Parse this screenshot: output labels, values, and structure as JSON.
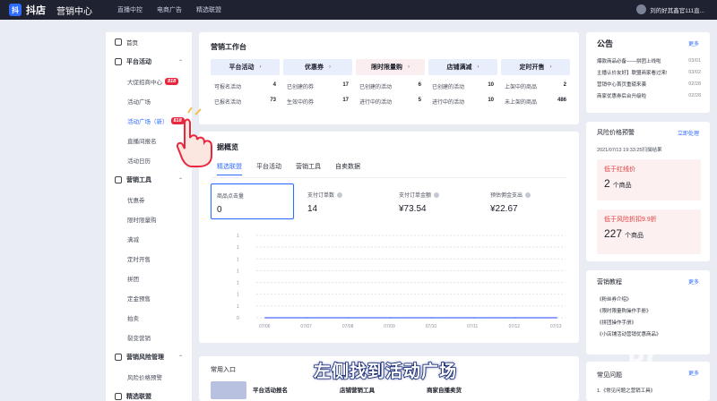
{
  "topbar": {
    "logo_char": "抖",
    "brand": "抖店",
    "section": "营销中心",
    "nav": [
      "直播中控",
      "电商广告",
      "精选联盟"
    ],
    "user": "刘的好其鑫官111直..."
  },
  "sidebar": {
    "items": [
      {
        "type": "top",
        "label": "首页",
        "icon": "home-icon"
      },
      {
        "type": "group",
        "label": "平台活动",
        "icon": "activity-icon"
      },
      {
        "type": "sub",
        "label": "大促招商中心",
        "badge": "818"
      },
      {
        "type": "sub",
        "label": "活动广场"
      },
      {
        "type": "sub",
        "label": "活动广场（新）",
        "badge": "818"
      },
      {
        "type": "sub",
        "label": "直播间报名"
      },
      {
        "type": "sub",
        "label": "活动日历"
      },
      {
        "type": "group",
        "label": "营销工具",
        "icon": "tool-icon"
      },
      {
        "type": "sub",
        "label": "优惠券"
      },
      {
        "type": "sub",
        "label": "限时限量购"
      },
      {
        "type": "sub",
        "label": "满减"
      },
      {
        "type": "sub",
        "label": "定时开售"
      },
      {
        "type": "sub",
        "label": "拼团"
      },
      {
        "type": "sub",
        "label": "定金预售"
      },
      {
        "type": "sub",
        "label": "拍卖"
      },
      {
        "type": "sub",
        "label": "裂变营销"
      },
      {
        "type": "group",
        "label": "营销风险管理",
        "icon": "shield-icon"
      },
      {
        "type": "sub",
        "label": "风险价格预警"
      },
      {
        "type": "group",
        "label": "精选联盟",
        "icon": "union-icon"
      }
    ]
  },
  "workbench": {
    "title": "营销工作台",
    "tiles": [
      {
        "name": "平台活动",
        "bg": "#e9eefc",
        "rows": [
          [
            "可报名活动",
            "4"
          ],
          [
            "已报名活动",
            "73"
          ]
        ]
      },
      {
        "name": "优惠券",
        "bg": "#e9eefc",
        "rows": [
          [
            "已创建的券",
            "17"
          ],
          [
            "生效中的券",
            "17"
          ]
        ]
      },
      {
        "name": "限时限量购",
        "bg": "#fbeef0",
        "rows": [
          [
            "已创建的活动",
            "6"
          ],
          [
            "进行中的活动",
            "5"
          ]
        ]
      },
      {
        "name": "店铺满减",
        "bg": "#e9eefc",
        "rows": [
          [
            "已创建的活动",
            "10"
          ],
          [
            "进行中的活动",
            "10"
          ]
        ]
      },
      {
        "name": "定时开售",
        "bg": "#e9eefc",
        "rows": [
          [
            "上架中的商品",
            "2"
          ],
          [
            "未上架的商品",
            "486"
          ]
        ]
      }
    ]
  },
  "overview": {
    "title": "据概览",
    "tabs": [
      "精选联盟",
      "平台活动",
      "营销工具",
      "自卖数据"
    ],
    "metrics": [
      {
        "label": "商品点击量",
        "value": "0"
      },
      {
        "label": "支付订单数",
        "value": "14"
      },
      {
        "label": "支付订单金额",
        "value": "¥73.54"
      },
      {
        "label": "预估佣金支出",
        "value": "¥22.67"
      }
    ]
  },
  "chart_data": {
    "type": "line",
    "x": [
      "07/06",
      "07/07",
      "07/08",
      "07/09",
      "07/10",
      "07/11",
      "07/12",
      "07/13"
    ],
    "values": [
      0,
      0,
      0,
      0,
      0,
      0,
      0,
      0
    ],
    "yticks": [
      "1",
      "1",
      "1",
      "1",
      "1",
      "1",
      "1",
      "0"
    ],
    "grid": true,
    "line_color": "#4d6bff"
  },
  "notice": {
    "title": "公告",
    "more": "更多",
    "items": [
      {
        "text": "爆款商品必备——拼团上线啦",
        "date": "03/01"
      },
      {
        "text": "主播认价友好】联盟商家看过来!",
        "date": "03/02"
      },
      {
        "text": "营销中心首页重磅来袭",
        "date": "02/28"
      },
      {
        "text": "商家优惠券后台升级啦",
        "date": "02/28"
      }
    ]
  },
  "price_warning": {
    "title": "风险价格预警",
    "action": "立即处理",
    "time": "2021/07/13 19:33:25扫描结果",
    "cards": [
      {
        "label": "低于红线价",
        "count": "2",
        "unit": "个商品"
      },
      {
        "label": "低于风险折扣9.9折",
        "count": "227",
        "unit": "个商品"
      }
    ]
  },
  "tutorial": {
    "title": "营销教程",
    "more": "更多",
    "items": [
      "《粉丝券介绍》",
      "《限时限量购操作手册》",
      "《拼团操作手册》",
      "《小店铺活动营销优惠商品》"
    ]
  },
  "faq": {
    "title": "常见问题",
    "more": "更多",
    "item": "1.《常见问题之营销工具》"
  },
  "entry": {
    "title": "常用入口",
    "items": [
      "平台活动报名",
      "店铺营销工具",
      "商家自播卖货"
    ]
  },
  "overlay": {
    "subtitle": "左侧找到活动广场",
    "watermark_big": "PC",
    "watermark_small": "PHPCMS.CN"
  }
}
